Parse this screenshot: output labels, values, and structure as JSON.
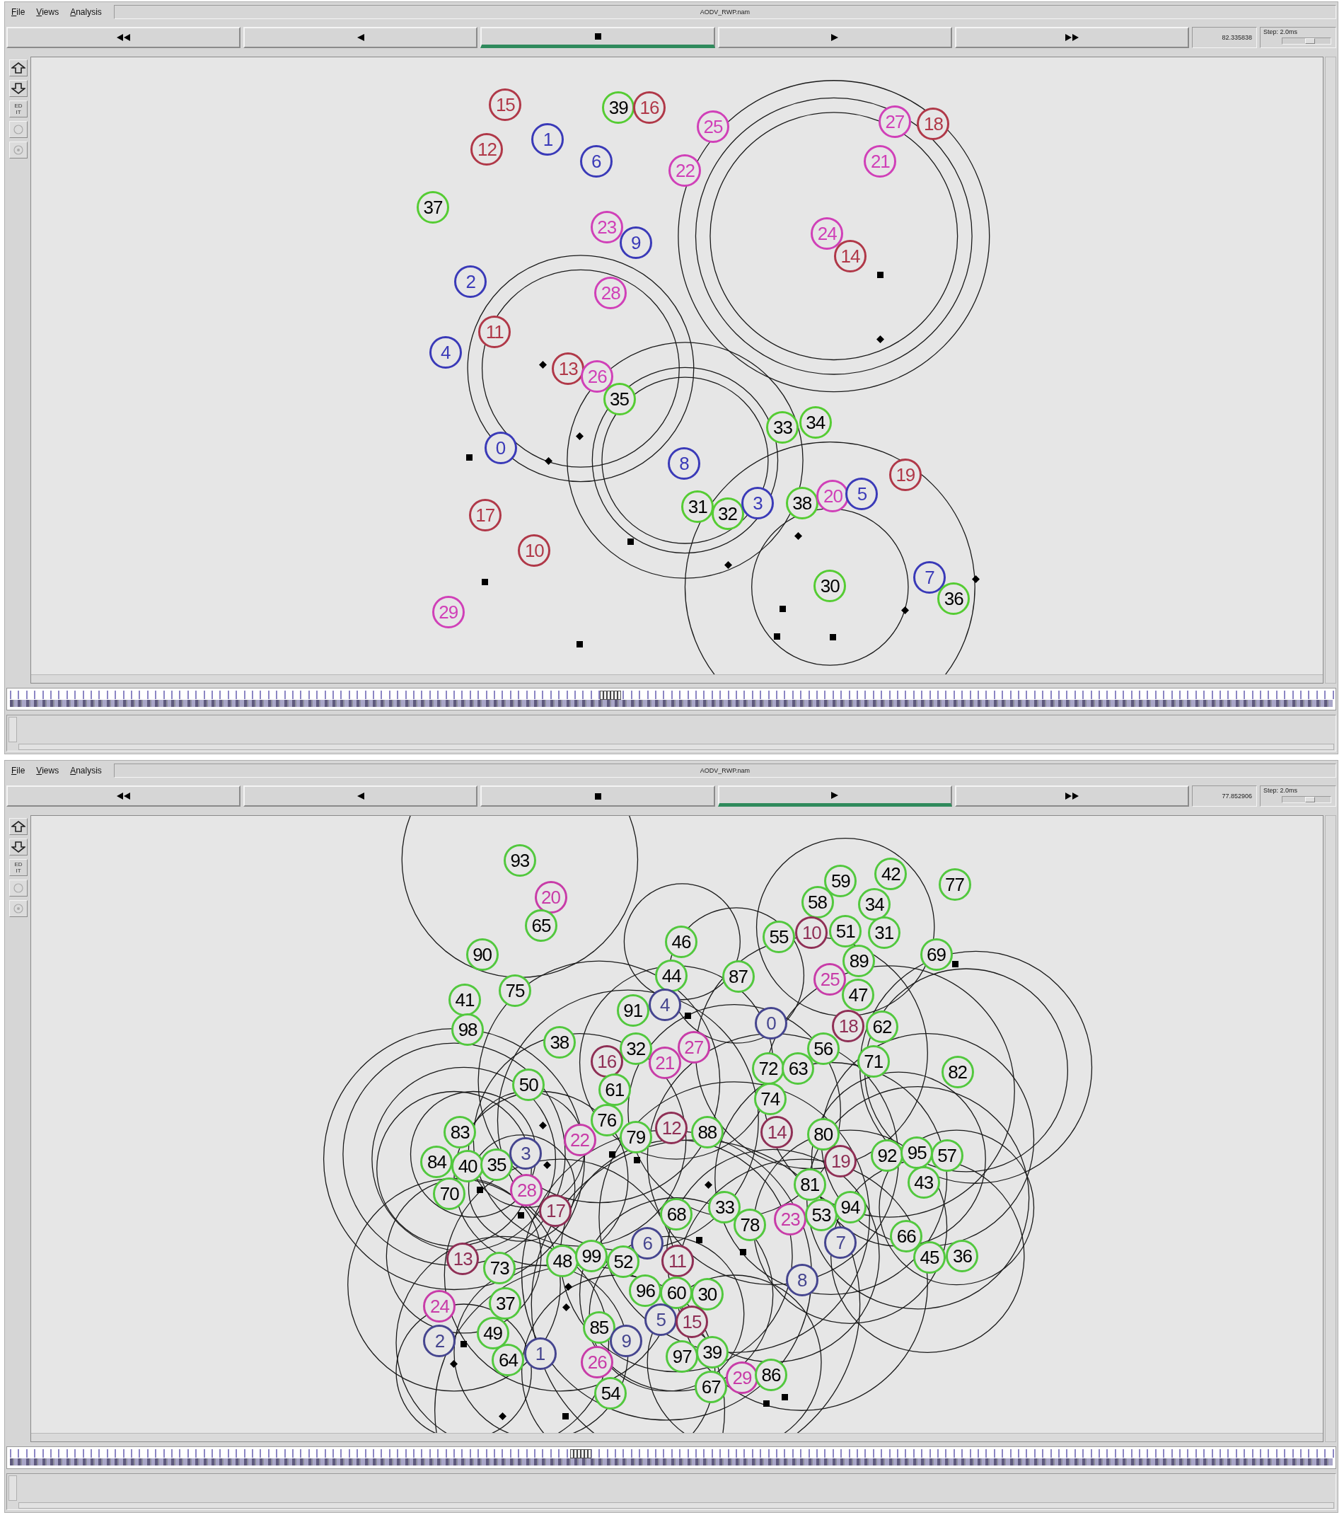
{
  "windows": [
    {
      "menu": [
        "File",
        "Views",
        "Analysis"
      ],
      "title": "AODV_RWP.nam",
      "controls": [
        {
          "kind": "rewind",
          "selected": false
        },
        {
          "kind": "back",
          "selected": false
        },
        {
          "kind": "stop",
          "selected": true
        },
        {
          "kind": "play",
          "selected": false
        },
        {
          "kind": "fast_forward",
          "selected": false
        }
      ],
      "time": "82.335838",
      "step": {
        "label": "Step: 2.0ms",
        "level": 0.6
      },
      "tools": [
        {
          "kind": "zoom_in",
          "disabled": false
        },
        {
          "kind": "zoom_out",
          "disabled": false
        },
        {
          "kind": "edit",
          "label": "EDIT",
          "disabled": false
        },
        {
          "kind": "circle",
          "disabled": true
        },
        {
          "kind": "dot",
          "disabled": true
        }
      ],
      "nodes": [
        {
          "label": "15",
          "color": "#b03848"
        },
        {
          "label": "39",
          "color": "#55cc33"
        },
        {
          "label": "16",
          "color": "#b03848"
        },
        {
          "label": "25",
          "color": "#d040b8"
        },
        {
          "label": "27",
          "color": "#d040b8"
        },
        {
          "label": "18",
          "color": "#b03848"
        },
        {
          "label": "12",
          "color": "#b03848"
        },
        {
          "label": "1",
          "color": "#3a3ab8"
        },
        {
          "label": "6",
          "color": "#3a3ab8"
        },
        {
          "label": "22",
          "color": "#d040b8"
        },
        {
          "label": "21",
          "color": "#d040b8"
        },
        {
          "label": "37",
          "color": "#55cc33"
        },
        {
          "label": "23",
          "color": "#d040b8"
        },
        {
          "label": "9",
          "color": "#3a3ab8"
        },
        {
          "label": "24",
          "color": "#d040b8"
        },
        {
          "label": "14",
          "color": "#b03848"
        },
        {
          "label": "2",
          "color": "#3a3ab8"
        },
        {
          "label": "28",
          "color": "#d040b8"
        },
        {
          "label": "11",
          "color": "#b03848"
        },
        {
          "label": "4",
          "color": "#3a3ab8"
        },
        {
          "label": "13",
          "color": "#b03848"
        },
        {
          "label": "26",
          "color": "#d040b8"
        },
        {
          "label": "35",
          "color": "#55cc33"
        },
        {
          "label": "33",
          "color": "#55cc33"
        },
        {
          "label": "34",
          "color": "#55cc33"
        },
        {
          "label": "0",
          "color": "#3a3ab8"
        },
        {
          "label": "8",
          "color": "#3a3ab8"
        },
        {
          "label": "19",
          "color": "#b03848"
        },
        {
          "label": "17",
          "color": "#b03848"
        },
        {
          "label": "31",
          "color": "#55cc33"
        },
        {
          "label": "32",
          "color": "#55cc33"
        },
        {
          "label": "3",
          "color": "#3a3ab8"
        },
        {
          "label": "38",
          "color": "#55cc33"
        },
        {
          "label": "20",
          "color": "#d040b8"
        },
        {
          "label": "5",
          "color": "#3a3ab8"
        },
        {
          "label": "10",
          "color": "#b03848"
        },
        {
          "label": "30",
          "color": "#55cc33"
        },
        {
          "label": "7",
          "color": "#3a3ab8"
        },
        {
          "label": "36",
          "color": "#55cc33"
        },
        {
          "label": "29",
          "color": "#d040b8"
        }
      ],
      "timeline": {
        "level": 0.454
      }
    },
    {
      "menu": [
        "File",
        "Views",
        "Analysis"
      ],
      "title": "AODV_RWP.nam",
      "controls": [
        {
          "kind": "rewind",
          "selected": false
        },
        {
          "kind": "back",
          "selected": false
        },
        {
          "kind": "stop",
          "selected": false
        },
        {
          "kind": "play",
          "selected": true
        },
        {
          "kind": "fast_forward",
          "selected": false
        }
      ],
      "time": "77.852906",
      "step": {
        "label": "Step: 2.0ms",
        "level": 0.6
      },
      "tools": [
        {
          "kind": "zoom_in",
          "disabled": false
        },
        {
          "kind": "zoom_out",
          "disabled": false
        },
        {
          "kind": "edit",
          "label": "EDIT",
          "disabled": false
        },
        {
          "kind": "circle",
          "disabled": true
        },
        {
          "kind": "dot",
          "disabled": true
        }
      ],
      "nodes": [
        {
          "label": "93",
          "color": "#52c83e"
        },
        {
          "label": "59",
          "color": "#52c83e"
        },
        {
          "label": "42",
          "color": "#52c83e"
        },
        {
          "label": "77",
          "color": "#52c83e"
        },
        {
          "label": "20",
          "color": "#c83ca8"
        },
        {
          "label": "58",
          "color": "#52c83e"
        },
        {
          "label": "34",
          "color": "#52c83e"
        },
        {
          "label": "65",
          "color": "#52c83e"
        },
        {
          "label": "46",
          "color": "#52c83e"
        },
        {
          "label": "55",
          "color": "#52c83e"
        },
        {
          "label": "10",
          "color": "#8f2f55"
        },
        {
          "label": "51",
          "color": "#52c83e"
        },
        {
          "label": "31",
          "color": "#52c83e"
        },
        {
          "label": "90",
          "color": "#52c83e"
        },
        {
          "label": "89",
          "color": "#52c83e"
        },
        {
          "label": "69",
          "color": "#52c83e"
        },
        {
          "label": "44",
          "color": "#52c83e"
        },
        {
          "label": "87",
          "color": "#52c83e"
        },
        {
          "label": "25",
          "color": "#c83ca8"
        },
        {
          "label": "41",
          "color": "#52c83e"
        },
        {
          "label": "75",
          "color": "#52c83e"
        },
        {
          "label": "91",
          "color": "#52c83e"
        },
        {
          "label": "4",
          "color": "#45458f"
        },
        {
          "label": "47",
          "color": "#52c83e"
        },
        {
          "label": "98",
          "color": "#52c83e"
        },
        {
          "label": "0",
          "color": "#45458f"
        },
        {
          "label": "18",
          "color": "#8f2f55"
        },
        {
          "label": "62",
          "color": "#52c83e"
        },
        {
          "label": "38",
          "color": "#52c83e"
        },
        {
          "label": "32",
          "color": "#52c83e"
        },
        {
          "label": "27",
          "color": "#c83ca8"
        },
        {
          "label": "56",
          "color": "#52c83e"
        },
        {
          "label": "16",
          "color": "#8f2f55"
        },
        {
          "label": "21",
          "color": "#c83ca8"
        },
        {
          "label": "72",
          "color": "#52c83e"
        },
        {
          "label": "63",
          "color": "#52c83e"
        },
        {
          "label": "71",
          "color": "#52c83e"
        },
        {
          "label": "82",
          "color": "#52c83e"
        },
        {
          "label": "50",
          "color": "#52c83e"
        },
        {
          "label": "61",
          "color": "#52c83e"
        },
        {
          "label": "74",
          "color": "#52c83e"
        },
        {
          "label": "83",
          "color": "#52c83e"
        },
        {
          "label": "22",
          "color": "#c83ca8"
        },
        {
          "label": "76",
          "color": "#52c83e"
        },
        {
          "label": "79",
          "color": "#52c83e"
        },
        {
          "label": "12",
          "color": "#8f2f55"
        },
        {
          "label": "88",
          "color": "#52c83e"
        },
        {
          "label": "14",
          "color": "#8f2f55"
        },
        {
          "label": "80",
          "color": "#52c83e"
        },
        {
          "label": "84",
          "color": "#52c83e"
        },
        {
          "label": "40",
          "color": "#52c83e"
        },
        {
          "label": "35",
          "color": "#52c83e"
        },
        {
          "label": "3",
          "color": "#45458f"
        },
        {
          "label": "19",
          "color": "#8f2f55"
        },
        {
          "label": "92",
          "color": "#52c83e"
        },
        {
          "label": "95",
          "color": "#52c83e"
        },
        {
          "label": "57",
          "color": "#52c83e"
        },
        {
          "label": "70",
          "color": "#52c83e"
        },
        {
          "label": "28",
          "color": "#c83ca8"
        },
        {
          "label": "81",
          "color": "#52c83e"
        },
        {
          "label": "43",
          "color": "#52c83e"
        },
        {
          "label": "17",
          "color": "#8f2f55"
        },
        {
          "label": "68",
          "color": "#52c83e"
        },
        {
          "label": "33",
          "color": "#52c83e"
        },
        {
          "label": "78",
          "color": "#52c83e"
        },
        {
          "label": "23",
          "color": "#c83ca8"
        },
        {
          "label": "53",
          "color": "#52c83e"
        },
        {
          "label": "94",
          "color": "#52c83e"
        },
        {
          "label": "6",
          "color": "#45458f"
        },
        {
          "label": "7",
          "color": "#45458f"
        },
        {
          "label": "66",
          "color": "#52c83e"
        },
        {
          "label": "13",
          "color": "#8f2f55"
        },
        {
          "label": "73",
          "color": "#52c83e"
        },
        {
          "label": "48",
          "color": "#52c83e"
        },
        {
          "label": "99",
          "color": "#52c83e"
        },
        {
          "label": "52",
          "color": "#52c83e"
        },
        {
          "label": "11",
          "color": "#8f2f55"
        },
        {
          "label": "45",
          "color": "#52c83e"
        },
        {
          "label": "36",
          "color": "#52c83e"
        },
        {
          "label": "24",
          "color": "#c83ca8"
        },
        {
          "label": "37",
          "color": "#52c83e"
        },
        {
          "label": "96",
          "color": "#52c83e"
        },
        {
          "label": "60",
          "color": "#52c83e"
        },
        {
          "label": "30",
          "color": "#52c83e"
        },
        {
          "label": "8",
          "color": "#45458f"
        },
        {
          "label": "2",
          "color": "#45458f"
        },
        {
          "label": "49",
          "color": "#52c83e"
        },
        {
          "label": "85",
          "color": "#52c83e"
        },
        {
          "label": "9",
          "color": "#45458f"
        },
        {
          "label": "5",
          "color": "#45458f"
        },
        {
          "label": "15",
          "color": "#8f2f55"
        },
        {
          "label": "64",
          "color": "#52c83e"
        },
        {
          "label": "1",
          "color": "#45458f"
        },
        {
          "label": "26",
          "color": "#c83ca8"
        },
        {
          "label": "97",
          "color": "#52c83e"
        },
        {
          "label": "39",
          "color": "#52c83e"
        },
        {
          "label": "54",
          "color": "#52c83e"
        },
        {
          "label": "67",
          "color": "#52c83e"
        },
        {
          "label": "29",
          "color": "#c83ca8"
        },
        {
          "label": "86",
          "color": "#52c83e"
        }
      ],
      "timeline": {
        "level": 0.431
      }
    }
  ]
}
